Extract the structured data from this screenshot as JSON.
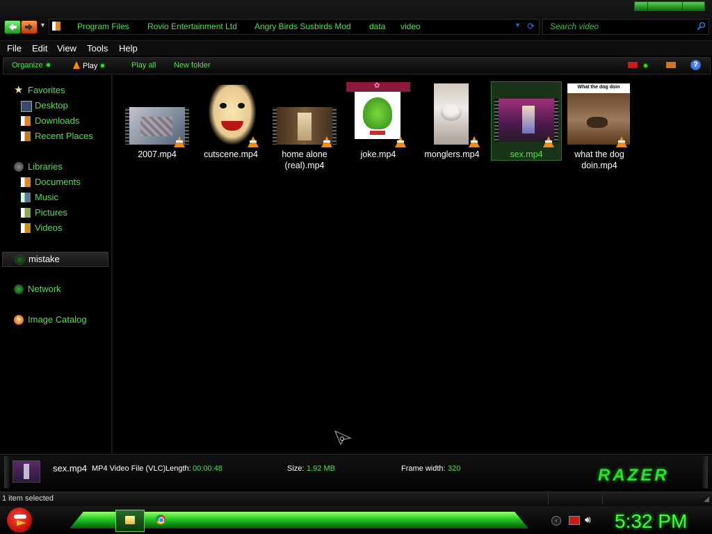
{
  "address": {
    "crumbs": [
      "Program Files",
      "Rovio Entertainment Ltd",
      "Angry Birds Susbirds Mod",
      "data",
      "video"
    ],
    "separator": "▸"
  },
  "search": {
    "placeholder": "Search video"
  },
  "menu": [
    "File",
    "Edit",
    "View",
    "Tools",
    "Help"
  ],
  "commands": {
    "organize": "Organize",
    "play": "Play",
    "play_all": "Play all",
    "new_folder": "New folder"
  },
  "nav": {
    "favorites": "Favorites",
    "desktop": "Desktop",
    "downloads": "Downloads",
    "recent": "Recent Places",
    "libraries": "Libraries",
    "documents": "Documents",
    "music": "Music",
    "pictures": "Pictures",
    "videos": "Videos",
    "mistake": "mistake",
    "network": "Network",
    "image_catalog": "Image Catalog"
  },
  "files": [
    {
      "name": "2007.mp4"
    },
    {
      "name": "cutscene.mp4"
    },
    {
      "name": "home alone (real).mp4"
    },
    {
      "name": "joke.mp4"
    },
    {
      "name": "monglers.mp4"
    },
    {
      "name": "sex.mp4",
      "selected": true
    },
    {
      "name": "what the dog doin.mp4",
      "caption": "What the dog doin"
    }
  ],
  "details": {
    "name": "sex.mp4",
    "type": "MP4 Video File (VLC)",
    "length_label": "Length:",
    "length": "00:00:48",
    "size_label": "Size:",
    "size": "1.92 MB",
    "frame_label": "Frame width:",
    "frame": "320",
    "brand": "RAZER"
  },
  "status": "1 item selected",
  "clock": "5:32 PM",
  "colors": {
    "accent": "#52e052",
    "background": "#000000",
    "selection": "#1f3a1f"
  }
}
